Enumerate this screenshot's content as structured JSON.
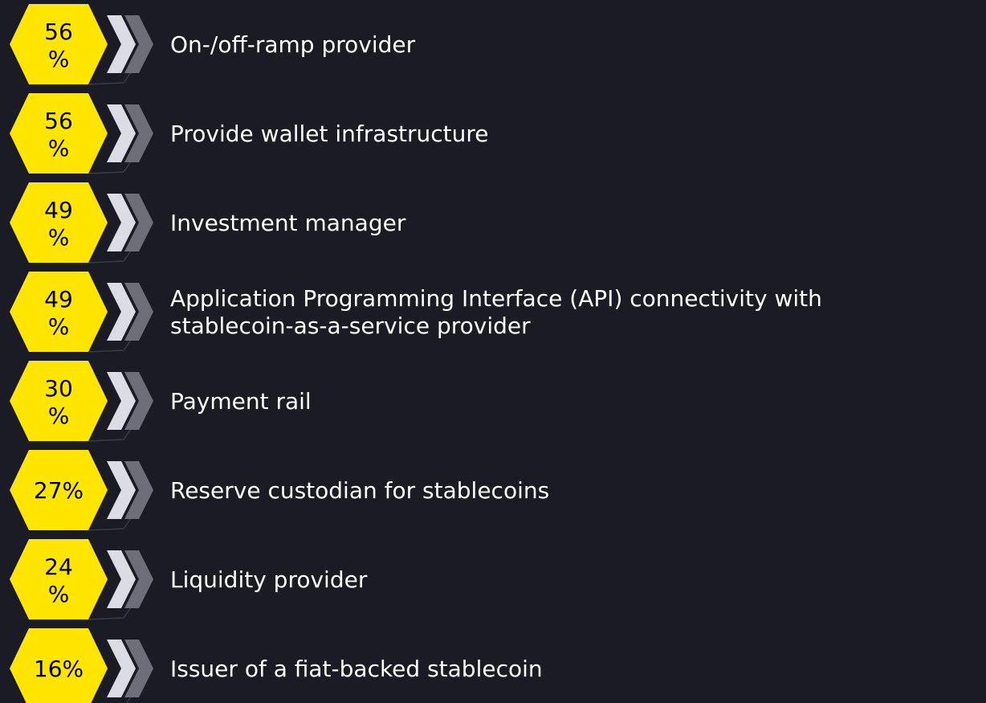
{
  "chart_data": {
    "type": "bar",
    "orientation": "list",
    "accent_color": "#ffe500",
    "background_color": "#1a1b24",
    "text_color": "#ffffff",
    "chevron_colors": [
      "#dcdce4",
      "#6e6e7a"
    ],
    "items": [
      {
        "value_text": "56\n%",
        "value": 56,
        "label": "On-/off-ramp provider"
      },
      {
        "value_text": "56\n%",
        "value": 56,
        "label": "Provide wallet infrastructure"
      },
      {
        "value_text": "49\n%",
        "value": 49,
        "label": "Investment manager"
      },
      {
        "value_text": "49\n%",
        "value": 49,
        "label": "Application Programming Interface (API) connectivity with\nstablecoin-as-a-service provider"
      },
      {
        "value_text": "30\n%",
        "value": 30,
        "label": "Payment rail"
      },
      {
        "value_text": "27%",
        "value": 27,
        "label": "Reserve custodian for stablecoins"
      },
      {
        "value_text": "24\n%",
        "value": 24,
        "label": "Liquidity provider"
      },
      {
        "value_text": "16%",
        "value": 16,
        "label": "Issuer of a fiat-backed stablecoin"
      }
    ]
  }
}
